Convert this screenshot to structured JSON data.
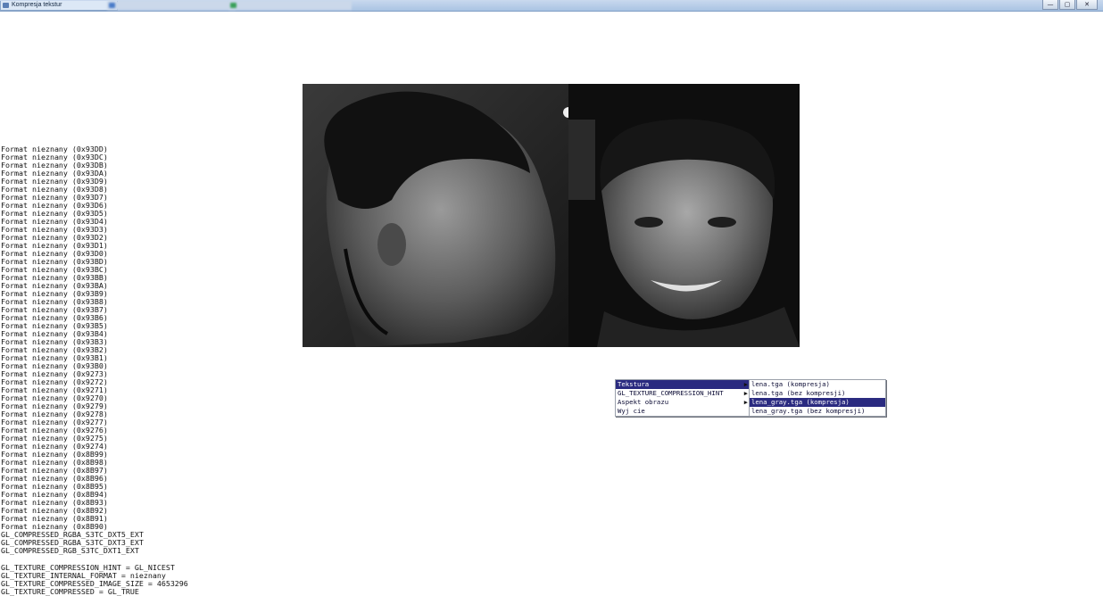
{
  "window": {
    "title": "Kompresja tekstur",
    "taskbar_items": [
      "Kompresja tekstur",
      "",
      ""
    ],
    "controls": {
      "minimize": "—",
      "maximize": "▢",
      "close": "✕"
    }
  },
  "formats_unknown": [
    "Format nieznany (0x93DD)",
    "Format nieznany (0x93DC)",
    "Format nieznany (0x93DB)",
    "Format nieznany (0x93DA)",
    "Format nieznany (0x93D9)",
    "Format nieznany (0x93D8)",
    "Format nieznany (0x93D7)",
    "Format nieznany (0x93D6)",
    "Format nieznany (0x93D5)",
    "Format nieznany (0x93D4)",
    "Format nieznany (0x93D3)",
    "Format nieznany (0x93D2)",
    "Format nieznany (0x93D1)",
    "Format nieznany (0x93D0)",
    "Format nieznany (0x93BD)",
    "Format nieznany (0x93BC)",
    "Format nieznany (0x93BB)",
    "Format nieznany (0x93BA)",
    "Format nieznany (0x93B9)",
    "Format nieznany (0x93B8)",
    "Format nieznany (0x93B7)",
    "Format nieznany (0x93B6)",
    "Format nieznany (0x93B5)",
    "Format nieznany (0x93B4)",
    "Format nieznany (0x93B3)",
    "Format nieznany (0x93B2)",
    "Format nieznany (0x93B1)",
    "Format nieznany (0x93B0)",
    "Format nieznany (0x9273)",
    "Format nieznany (0x9272)",
    "Format nieznany (0x9271)",
    "Format nieznany (0x9270)",
    "Format nieznany (0x9279)",
    "Format nieznany (0x9278)",
    "Format nieznany (0x9277)",
    "Format nieznany (0x9276)",
    "Format nieznany (0x9275)",
    "Format nieznany (0x9274)",
    "Format nieznany (0x8B99)",
    "Format nieznany (0x8B98)",
    "Format nieznany (0x8B97)",
    "Format nieznany (0x8B96)",
    "Format nieznany (0x8B95)",
    "Format nieznany (0x8B94)",
    "Format nieznany (0x8B93)",
    "Format nieznany (0x8B92)",
    "Format nieznany (0x8B91)",
    "Format nieznany (0x8B90)",
    "GL_COMPRESSED_RGBA_S3TC_DXT5_EXT",
    "GL_COMPRESSED_RGBA_S3TC_DXT3_EXT",
    "GL_COMPRESSED_RGB_S3TC_DXT1_EXT"
  ],
  "gl_info": [
    "GL_TEXTURE_COMPRESSION_HINT = GL_NICEST",
    "GL_TEXTURE_INTERNAL_FORMAT = nieznany",
    "GL_TEXTURE_COMPRESSED_IMAGE_SIZE = 4653296",
    "GL_TEXTURE_COMPRESSED = GL_TRUE"
  ],
  "context_menu": {
    "items": [
      {
        "label": "Tekstura",
        "submenu": true,
        "highlighted": true
      },
      {
        "label": "GL_TEXTURE_COMPRESSION_HINT",
        "submenu": true,
        "highlighted": false
      },
      {
        "label": "Aspekt obrazu",
        "submenu": true,
        "highlighted": false
      },
      {
        "label": "Wyj cie",
        "submenu": false,
        "highlighted": false
      }
    ],
    "submenu_items": [
      {
        "label": "lena.tga (kompresja)",
        "highlighted": false
      },
      {
        "label": "lena.tga (bez kompresji)",
        "highlighted": false
      },
      {
        "label": "lena_gray.tga (kompresja)",
        "highlighted": true
      },
      {
        "label": "lena_gray.tga (bez kompresji)",
        "highlighted": false
      }
    ],
    "arrow_glyph": "▶"
  },
  "colors": {
    "menu_highlight": "#2a2a80",
    "menu_highlight_text": "#ffffff",
    "text": "#111111"
  }
}
